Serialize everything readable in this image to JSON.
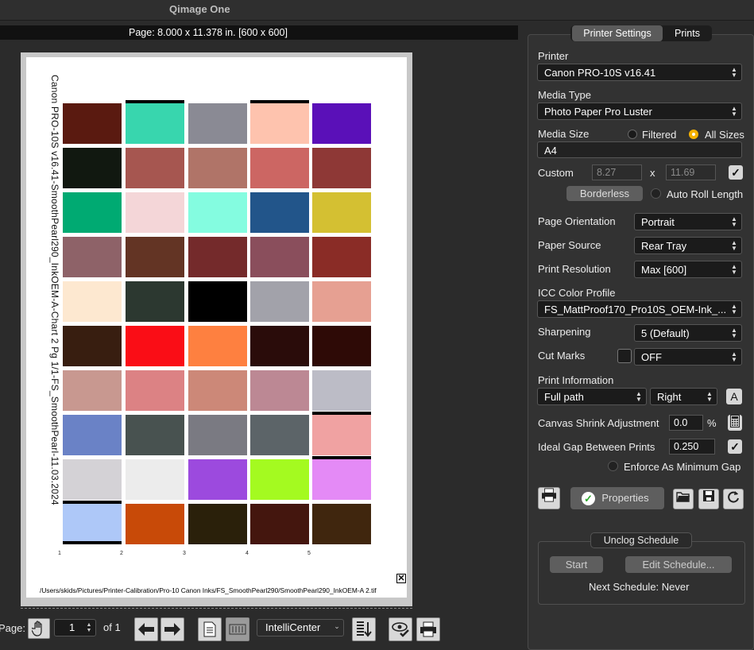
{
  "app": {
    "title": "Qimage One"
  },
  "page_info": "Page: 8.000 x 11.378 in. [600 x 600]",
  "chart": {
    "title": "Canon PRO-10S v16.41-SmoothPearl290_InkOEM-A-Chart 2 Pg 1/1-FS_SmoothPearl-11.03.2024",
    "file_path": "/Users/skids/Pictures/Printer-Calibration/Pro-10 Canon Inks/FS_SmoothPearl290/SmoothPearl290_InkOEM-A 2.tif",
    "close_symbol": "✕",
    "column_numbers": [
      "1",
      "2",
      "3",
      "4",
      "5"
    ],
    "patches": [
      [
        "#5a1a10",
        "#38d6ae",
        "#8a8a94",
        "#fec3ae",
        "#5a10b8"
      ],
      [
        "#111810",
        "#a65650",
        "#b07468",
        "#cc6663",
        "#8e3836"
      ],
      [
        "#00aa72",
        "#f4d6d8",
        "#84fce0",
        "#22558a",
        "#d4c032"
      ],
      [
        "#8e6268",
        "#633424",
        "#742a2b",
        "#8a4e5c",
        "#8a2c26"
      ],
      [
        "#fde8d0",
        "#2c3830",
        "#000000",
        "#a2a2aa",
        "#e6a092"
      ],
      [
        "#381e10",
        "#fa0d16",
        "#fe8040",
        "#2a0c0a",
        "#2e0a06"
      ],
      [
        "#c89890",
        "#dc8284",
        "#cc8878",
        "#bc8894",
        "#bcbcc6"
      ],
      [
        "#6a82c6",
        "#485250",
        "#7a7a82",
        "#5c6468",
        "#f0a2a2"
      ],
      [
        "#d4d2d6",
        "#ececec",
        "#9c4ade",
        "#a4fa20",
        "#e48af6"
      ],
      [
        "#aec8f8",
        "#c84a08",
        "#2a200a",
        "#44160e",
        "#40260e"
      ]
    ]
  },
  "bottom": {
    "page_label": "Page:",
    "page_number": "1",
    "of_label": "of 1",
    "layout_mode": "IntelliCenter",
    "icons": {
      "hand": "hand-icon",
      "prev": "arrow-left-icon",
      "next": "arrow-right-icon",
      "page": "page-icon",
      "film": "filmstrip-icon",
      "sort": "sort-down-icon",
      "preview": "eye-check-icon",
      "print": "printer-icon"
    }
  },
  "tabs": [
    "Printer Settings",
    "Prints"
  ],
  "settings": {
    "printer_label": "Printer",
    "printer_value": "Canon PRO-10S v16.41",
    "media_type_label": "Media Type",
    "media_type_value": "Photo Paper Pro Luster",
    "media_size_label": "Media Size",
    "filtered_label": "Filtered",
    "all_sizes_label": "All Sizes",
    "media_size_value": "A4",
    "custom_label": "Custom",
    "custom_w": "8.27",
    "custom_x": "x",
    "custom_h": "11.69",
    "borderless_label": "Borderless",
    "auto_roll_label": "Auto Roll Length",
    "orientation_label": "Page Orientation",
    "orientation_value": "Portrait",
    "paper_source_label": "Paper Source",
    "paper_source_value": "Rear Tray",
    "resolution_label": "Print Resolution",
    "resolution_value": "Max [600]",
    "icc_label": "ICC Color Profile",
    "icc_value": "FS_MattProof170_Pro10S_OEM-Ink_...",
    "sharpening_label": "Sharpening",
    "sharpening_value": "5 (Default)",
    "cut_marks_label": "Cut Marks",
    "cut_marks_value": "OFF",
    "print_info_label": "Print Information",
    "print_info_value": "Full path",
    "print_info_pos": "Right",
    "font_glyph": "A",
    "shrink_label": "Canvas Shrink Adjustment",
    "shrink_value": "0.0",
    "shrink_unit": "%",
    "gap_label": "Ideal Gap Between Prints",
    "gap_value": "0.250",
    "enforce_label": "Enforce As Minimum Gap",
    "properties_label": "Properties"
  },
  "unclog": {
    "title": "Unclog Schedule",
    "start_label": "Start",
    "edit_label": "Edit Schedule...",
    "next_schedule": "Next Schedule: Never"
  },
  "colors": {
    "accent_radio": "#f5b100",
    "properties_check": "#2ea82e"
  }
}
